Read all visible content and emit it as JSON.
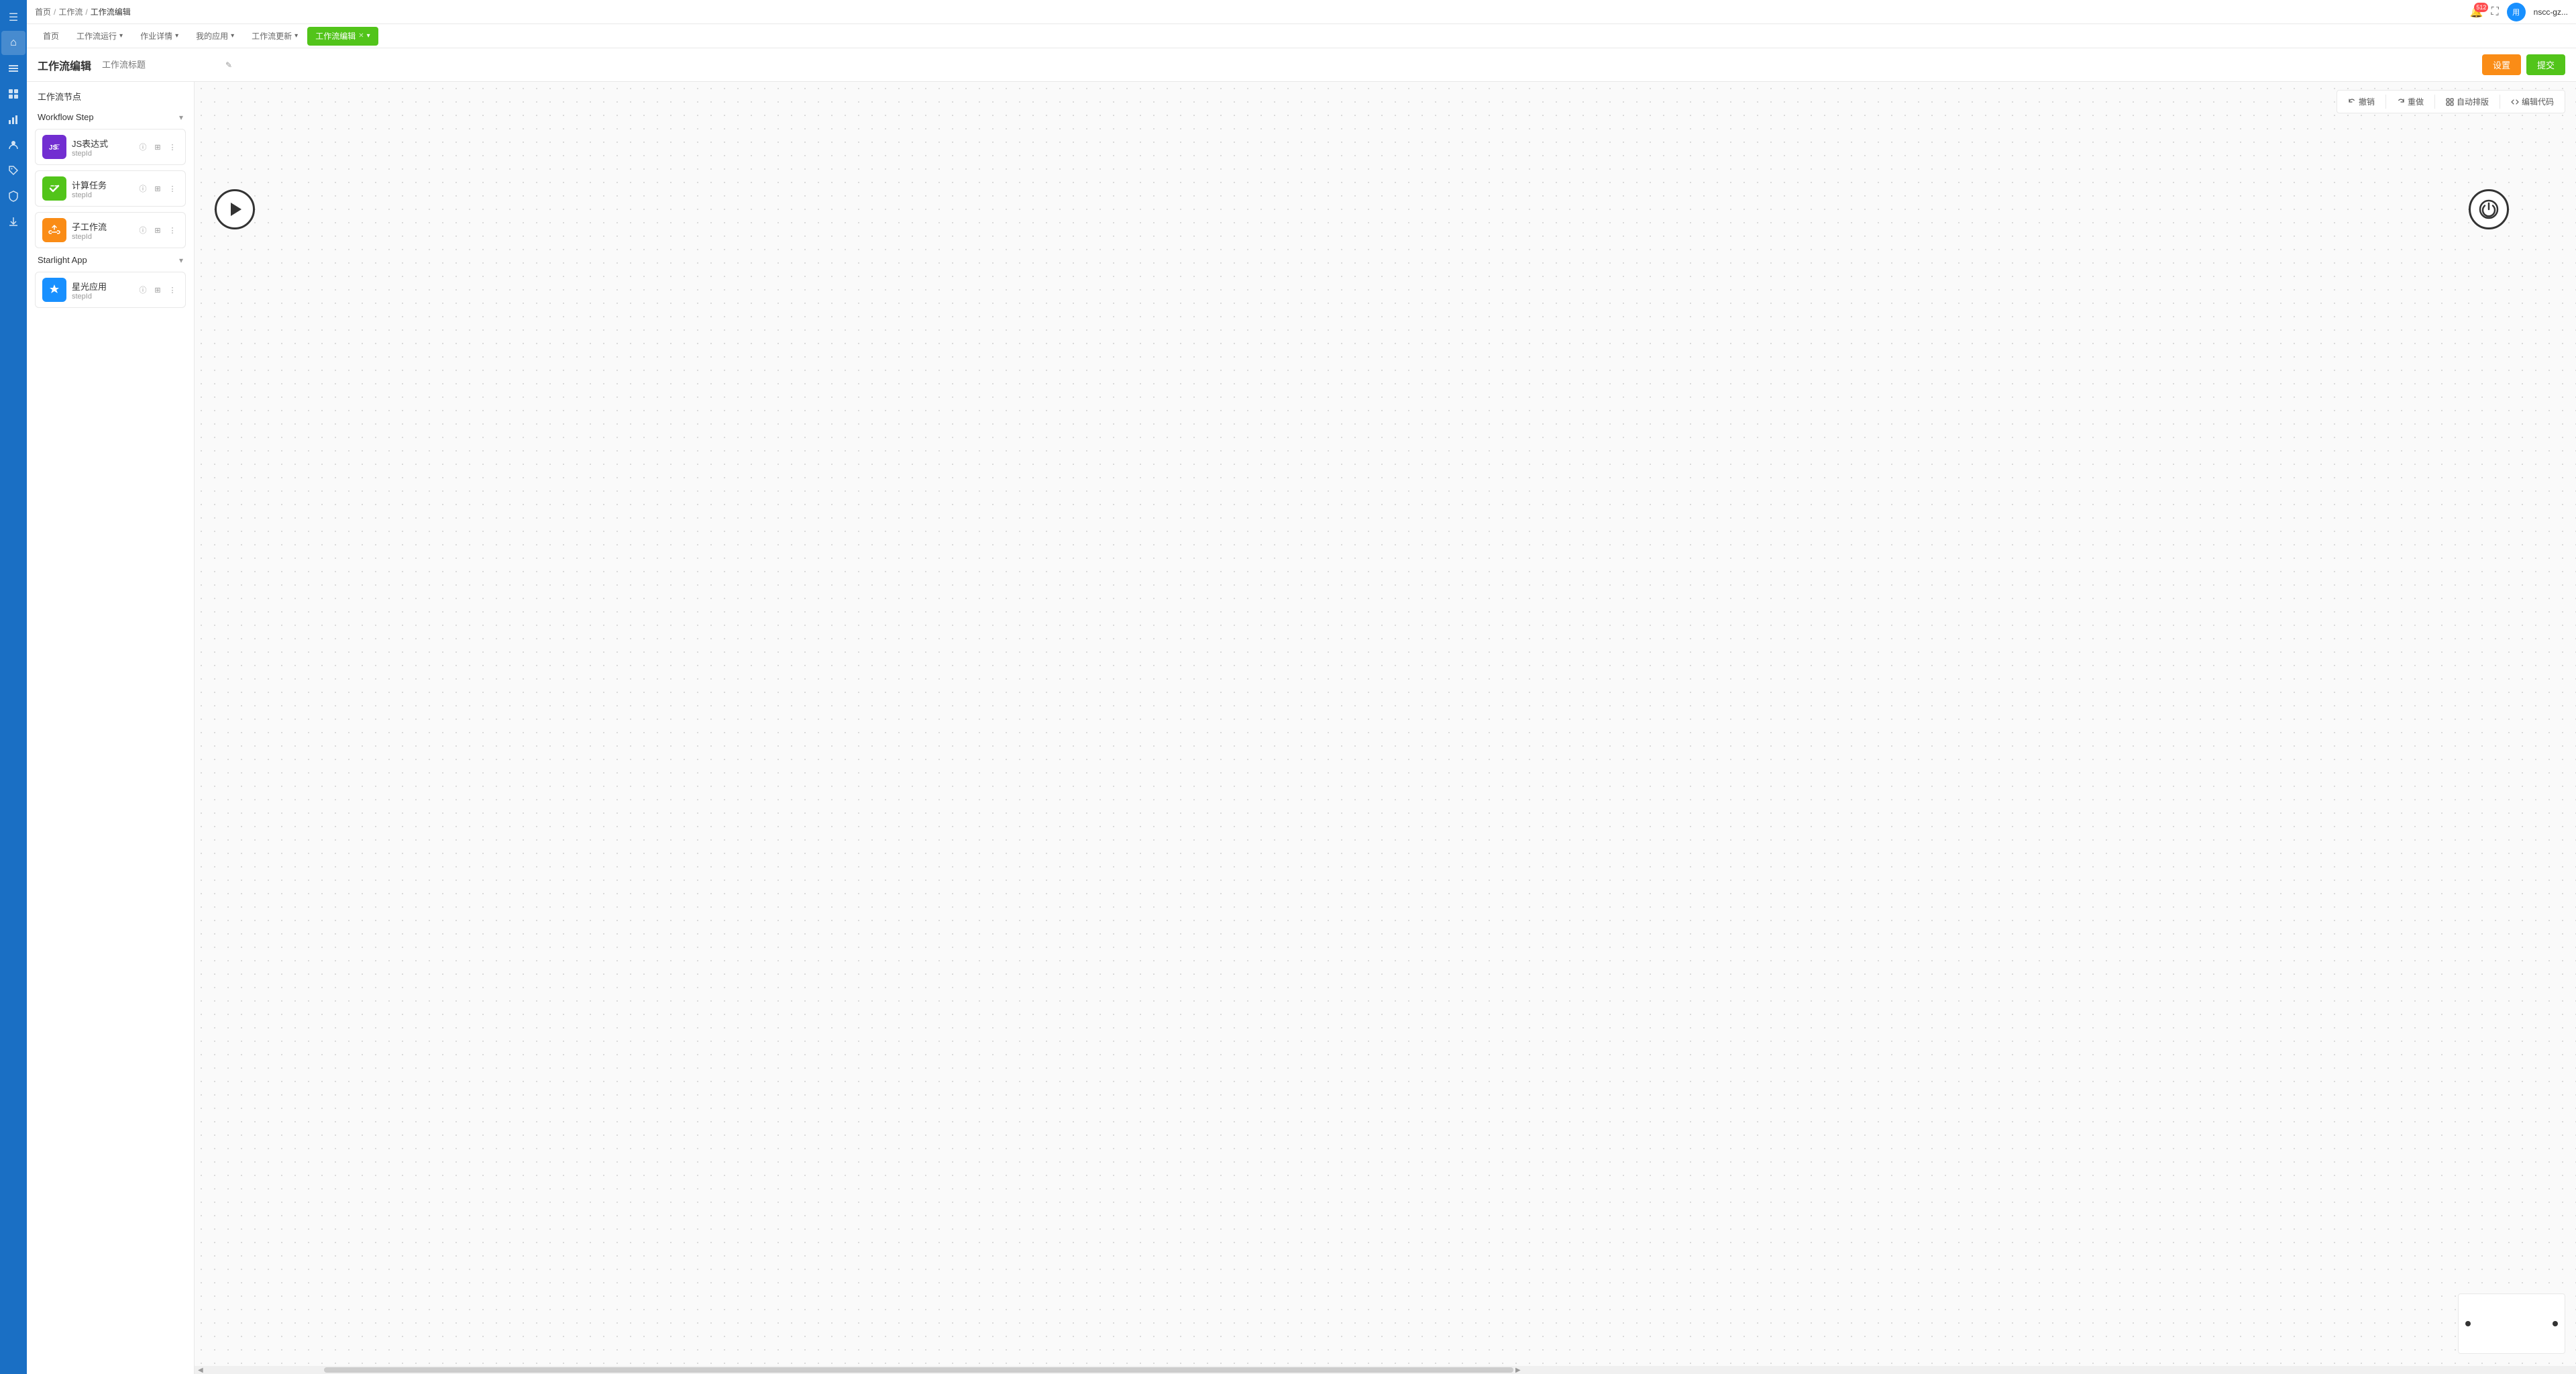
{
  "sidebar": {
    "icons": [
      {
        "name": "menu-icon",
        "symbol": "☰"
      },
      {
        "name": "home-icon",
        "symbol": "⌂"
      },
      {
        "name": "list-icon",
        "symbol": "≡"
      },
      {
        "name": "grid-icon",
        "symbol": "▦"
      },
      {
        "name": "chart-icon",
        "symbol": "📊"
      },
      {
        "name": "people-icon",
        "symbol": "👥"
      },
      {
        "name": "tag-icon",
        "symbol": "🏷"
      },
      {
        "name": "shield-icon",
        "symbol": "🛡"
      },
      {
        "name": "download-icon",
        "symbol": "⬇"
      }
    ]
  },
  "topbar": {
    "menu_label": "☰",
    "breadcrumb": {
      "home": "首页",
      "sep1": "/",
      "workflow": "工作流",
      "sep2": "/",
      "current": "工作流编辑"
    },
    "notification_count": "512",
    "username": "nscc-gz..."
  },
  "tabs": [
    {
      "id": "home",
      "label": "首页",
      "active": false,
      "closable": false
    },
    {
      "id": "workflow-run",
      "label": "工作流运行",
      "active": false,
      "closable": false,
      "has_arrow": true
    },
    {
      "id": "job-details",
      "label": "作业详情",
      "active": false,
      "closable": false,
      "has_arrow": true
    },
    {
      "id": "my-apps",
      "label": "我的应用",
      "active": false,
      "closable": false,
      "has_arrow": true
    },
    {
      "id": "workflow-update",
      "label": "工作流更新",
      "active": false,
      "closable": false,
      "has_arrow": true
    },
    {
      "id": "workflow-edit",
      "label": "工作流编辑",
      "active": true,
      "closable": true,
      "has_arrow": true
    }
  ],
  "workflow_editor": {
    "title": "工作流编辑",
    "title_input_placeholder": "工作流标题",
    "btn_settings": "设置",
    "btn_submit": "提交"
  },
  "nodes_panel": {
    "title": "工作流节点",
    "groups": [
      {
        "id": "workflow-step",
        "label": "Workflow Step",
        "collapsed": false,
        "nodes": [
          {
            "id": "js-expr",
            "name": "JS表达式",
            "stepId": "stepId",
            "icon_type": "js",
            "icon_text": "JS"
          },
          {
            "id": "calc-task",
            "name": "计算任务",
            "stepId": "stepId",
            "icon_type": "calc",
            "icon_text": "≫"
          },
          {
            "id": "sub-workflow",
            "name": "子工作流",
            "stepId": "stepId",
            "icon_type": "sub",
            "icon_text": "⟲"
          }
        ]
      },
      {
        "id": "starlight-app",
        "label": "Starlight App",
        "collapsed": false,
        "nodes": [
          {
            "id": "starlight",
            "name": "星光应用",
            "stepId": "stepId",
            "icon_type": "star",
            "icon_text": "⬡"
          }
        ]
      }
    ]
  },
  "canvas": {
    "toolbar": {
      "undo_label": "撤销",
      "redo_label": "重做",
      "auto_layout_label": "自动排版",
      "edit_code_label": "编辑代码"
    }
  }
}
